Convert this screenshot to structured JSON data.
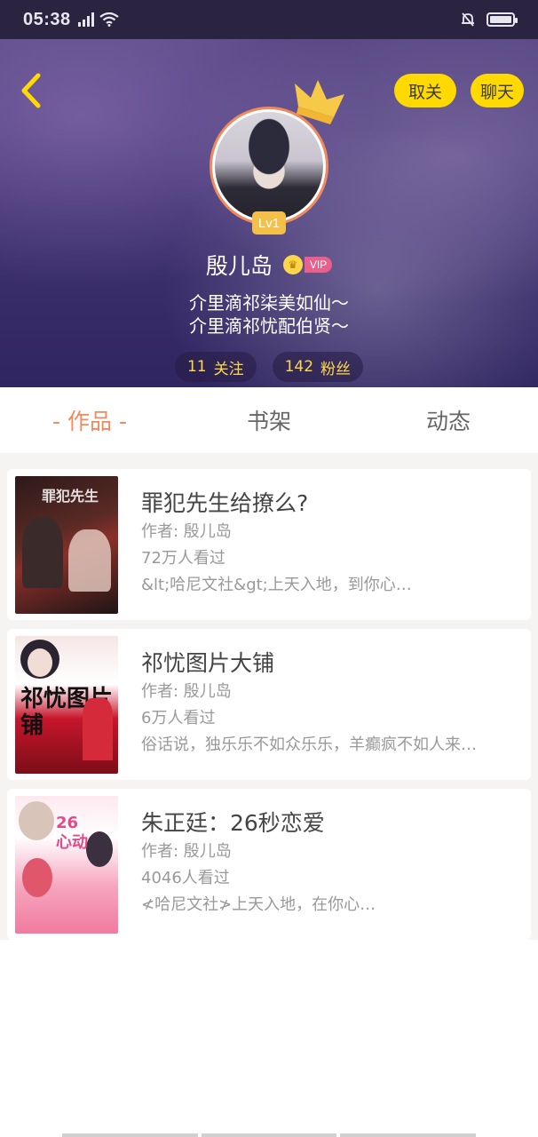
{
  "status_bar": {
    "time": "05:38",
    "signal_label": "4G"
  },
  "header": {
    "back_icon": "chevron-left-icon",
    "unfollow_label": "取关",
    "chat_label": "聊天",
    "level": "Lv1",
    "username": "殷儿岛",
    "vip_label": "VIP",
    "bio_lines": [
      "介里滴祁柒美如仙～",
      "介里滴祁忧配伯贤～"
    ],
    "following_count": "11",
    "following_label": "关注",
    "fans_count": "142",
    "fans_label": "粉丝",
    "accent_color": "#ffd900",
    "avatar_ring_color": "#f08a5d"
  },
  "tabs": [
    {
      "label": "- 作品 -",
      "active": true
    },
    {
      "label": "书架",
      "active": false
    },
    {
      "label": "动态",
      "active": false
    }
  ],
  "books": [
    {
      "title": "罪犯先生给撩么?",
      "author": "作者: 殷儿岛",
      "views": "72万人看过",
      "summary": "&lt;哈尼文社&gt;上天入地，到你心…",
      "cover_text": "罪犯先生"
    },
    {
      "title": "祁忧图片大铺",
      "author": "作者: 殷儿岛",
      "views": "6万人看过",
      "summary": "俗话说，独乐乐不如众乐乐，羊癫疯不如人来…",
      "cover_text": "祁忧图片铺"
    },
    {
      "title": "朱正廷：26秒恋爱",
      "author": "作者: 殷儿岛",
      "views": "4046人看过",
      "summary": "≮哈尼文社≯上天入地，在你心…",
      "cover_text": "26 心动"
    }
  ]
}
